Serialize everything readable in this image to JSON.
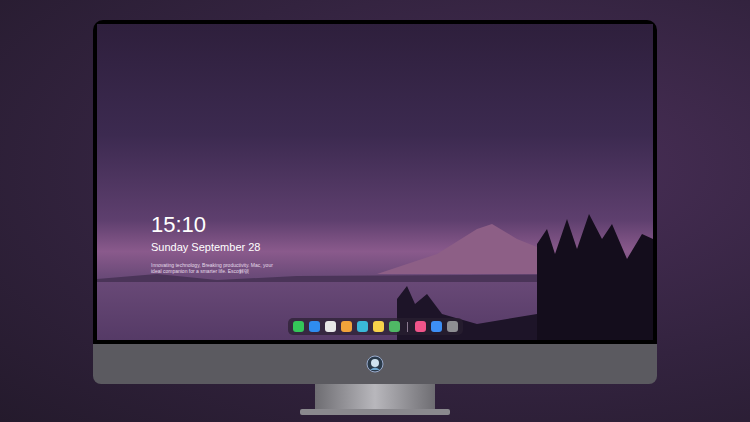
{
  "screen": {
    "clock": {
      "time": "15:10",
      "date": "Sunday September 28",
      "tagline": "Innovating technology, Breaking productivity. Mac, your ideal companion for a smarter life. Esco解锁"
    }
  },
  "dock": {
    "items": [
      {
        "kind": "app",
        "color": "#34c759"
      },
      {
        "kind": "app",
        "color": "#2f8cf0"
      },
      {
        "kind": "app",
        "color": "#e8e8e8"
      },
      {
        "kind": "app",
        "color": "#f2a33a"
      },
      {
        "kind": "app",
        "color": "#3ab8d8"
      },
      {
        "kind": "app",
        "color": "#f7d24a"
      },
      {
        "kind": "app",
        "color": "#4fb865"
      },
      {
        "kind": "separator",
        "color": "#8a7a90"
      },
      {
        "kind": "app",
        "color": "#f0548a"
      },
      {
        "kind": "app",
        "color": "#3d8ef5"
      },
      {
        "kind": "app",
        "color": "#8e8e93"
      }
    ]
  }
}
